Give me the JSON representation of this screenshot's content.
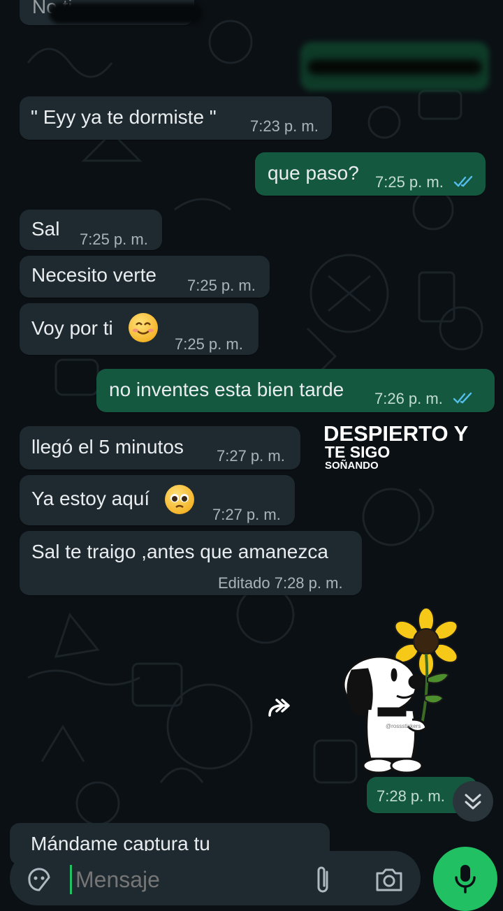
{
  "chat": {
    "partial_top": "No ti",
    "messages": [
      {
        "dir": "in",
        "text": "\" Eyy ya te  dormiste \"",
        "time": "7:23 p. m."
      },
      {
        "dir": "out",
        "text": "que paso?",
        "time": "7:25 p. m.",
        "status": "read"
      },
      {
        "dir": "in",
        "text": "Sal",
        "time": "7:25 p. m."
      },
      {
        "dir": "in",
        "text": "Necesito verte",
        "time": "7:25 p. m."
      },
      {
        "dir": "in",
        "text": "Voy por ti",
        "emoji": "smiling-face-emoji",
        "time": "7:25 p. m."
      },
      {
        "dir": "out",
        "text": "no inventes esta bien tarde",
        "time": "7:26 p. m.",
        "status": "read"
      },
      {
        "dir": "in",
        "text": "llegó el 5 minutos",
        "time": "7:27 p. m."
      },
      {
        "dir": "in",
        "text": "Ya estoy aquí",
        "emoji": "pleading-face-emoji",
        "time": "7:27 p. m."
      },
      {
        "dir": "in",
        "text": "Sal te traigo ,antes que amanezca",
        "time": "Editado 7:28 p. m."
      },
      {
        "dir": "out",
        "sticker": "snoopy-sunflower-sticker",
        "time": "7:28 p. m."
      }
    ],
    "partial_bottom": "Mándame captura tu"
  },
  "sticker": {
    "line1": "DESPIERTO Y",
    "line2": "TE SIGO",
    "line3": "SOÑANDO",
    "watermark": "@rossstickers"
  },
  "composer": {
    "placeholder": "Mensaje",
    "icons": [
      "sticker-icon",
      "attach-icon",
      "camera-icon",
      "mic-icon"
    ]
  },
  "colors": {
    "background": "#0b1014",
    "incoming": "#1f2a30",
    "outgoing": "#155840",
    "ticks": "#53bdeb",
    "mic_button": "#21c063"
  }
}
